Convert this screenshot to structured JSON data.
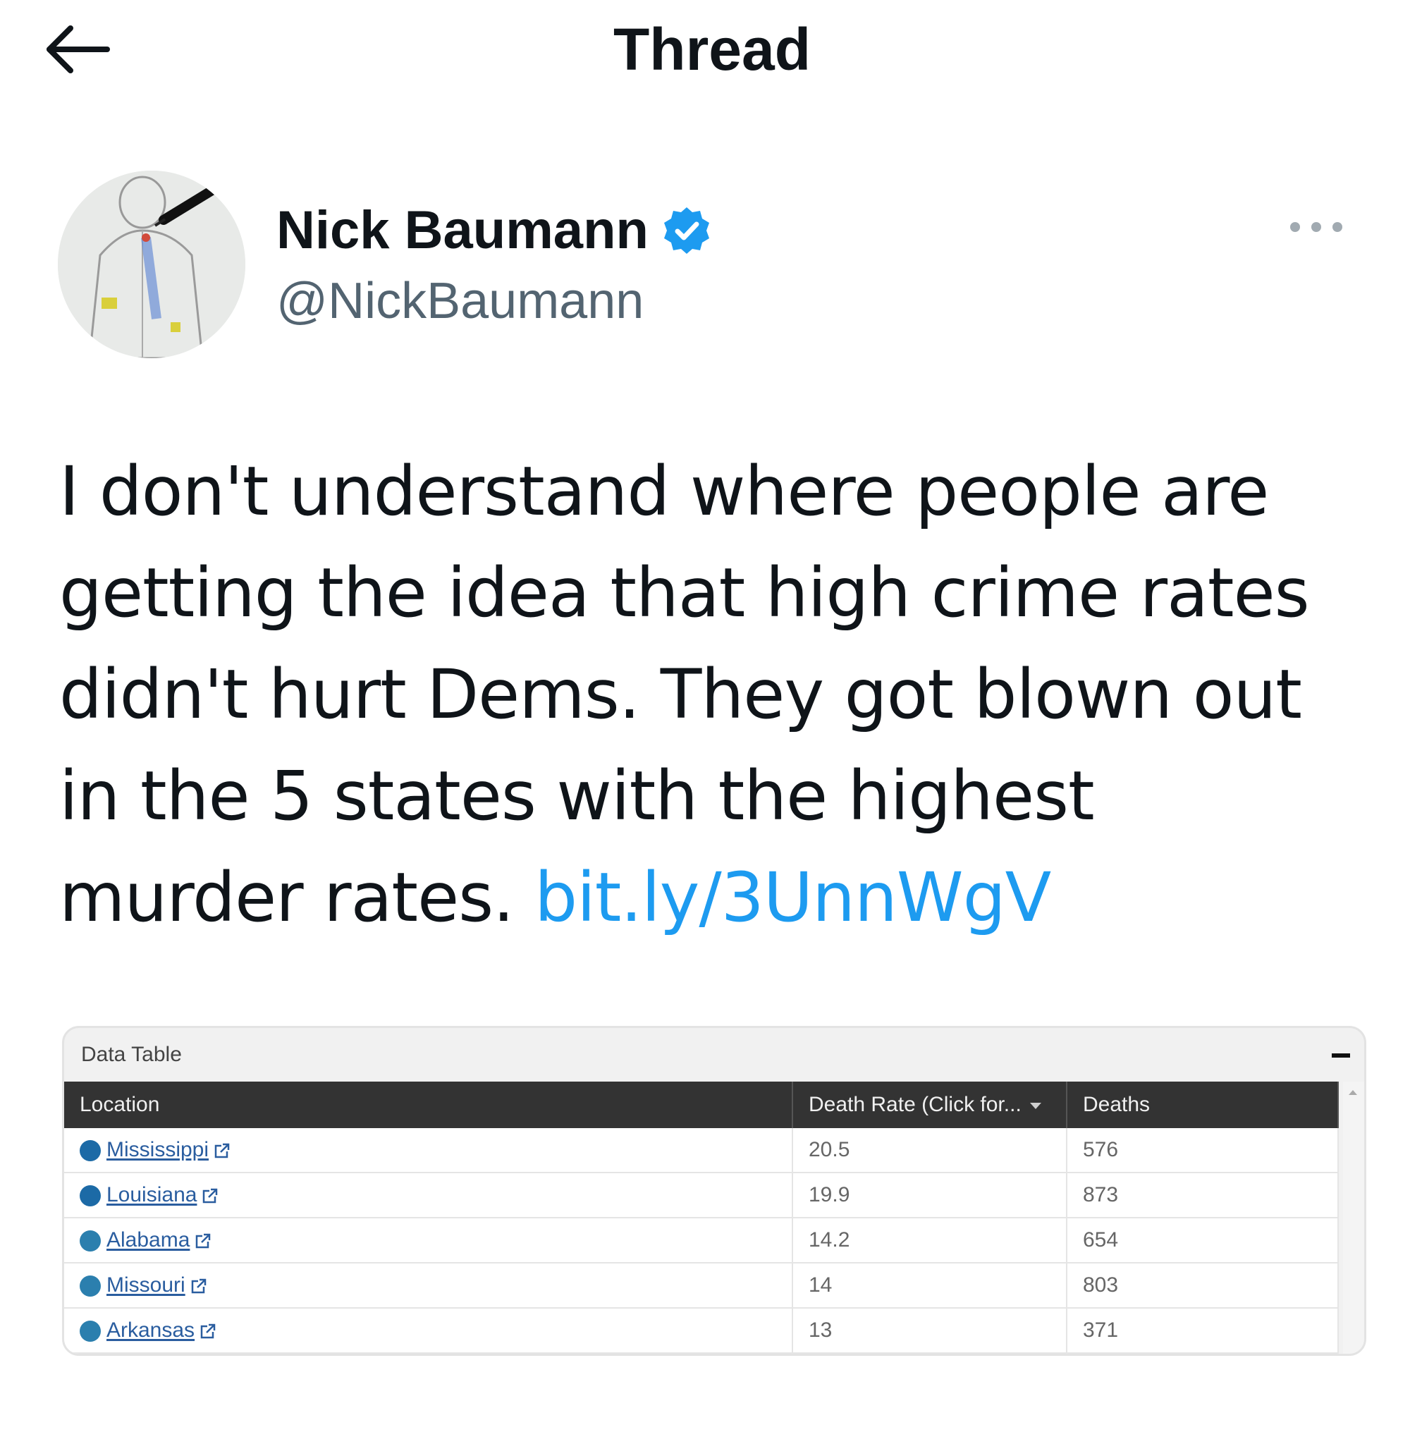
{
  "header": {
    "title": "Thread",
    "back_icon": "arrow-left-icon"
  },
  "tweet": {
    "author": {
      "name": "Nick Baumann",
      "handle": "@NickBaumann",
      "verified": true,
      "verified_color": "#1d9bf0"
    },
    "text_lines": [
      "I don't understand where people are",
      "getting the idea that high crime rates",
      "didn't hurt Dems. They got blown out",
      "in the 5 states with the highest",
      "murder rates. "
    ],
    "link_text": "bit.ly/3UnnWgV",
    "more_icon": "more-horizontal-icon"
  },
  "media": {
    "title": "Data Table",
    "columns": [
      "Location",
      "Death Rate (Click for...",
      "Deaths"
    ],
    "rows": [
      {
        "location": "Mississippi",
        "rate": "20.5",
        "deaths": "576",
        "dot_color": "#1c6aa6"
      },
      {
        "location": "Louisiana",
        "rate": "19.9",
        "deaths": "873",
        "dot_color": "#1c6aa6"
      },
      {
        "location": "Alabama",
        "rate": "14.2",
        "deaths": "654",
        "dot_color": "#2b7fae"
      },
      {
        "location": "Missouri",
        "rate": "14",
        "deaths": "803",
        "dot_color": "#2b7fae"
      },
      {
        "location": "Arkansas",
        "rate": "13",
        "deaths": "371",
        "dot_color": "#2b7fae"
      }
    ]
  },
  "colors": {
    "text": "#0f1419",
    "secondary_text": "#536471",
    "link": "#1d9bf0",
    "table_header_bg": "#333333"
  }
}
